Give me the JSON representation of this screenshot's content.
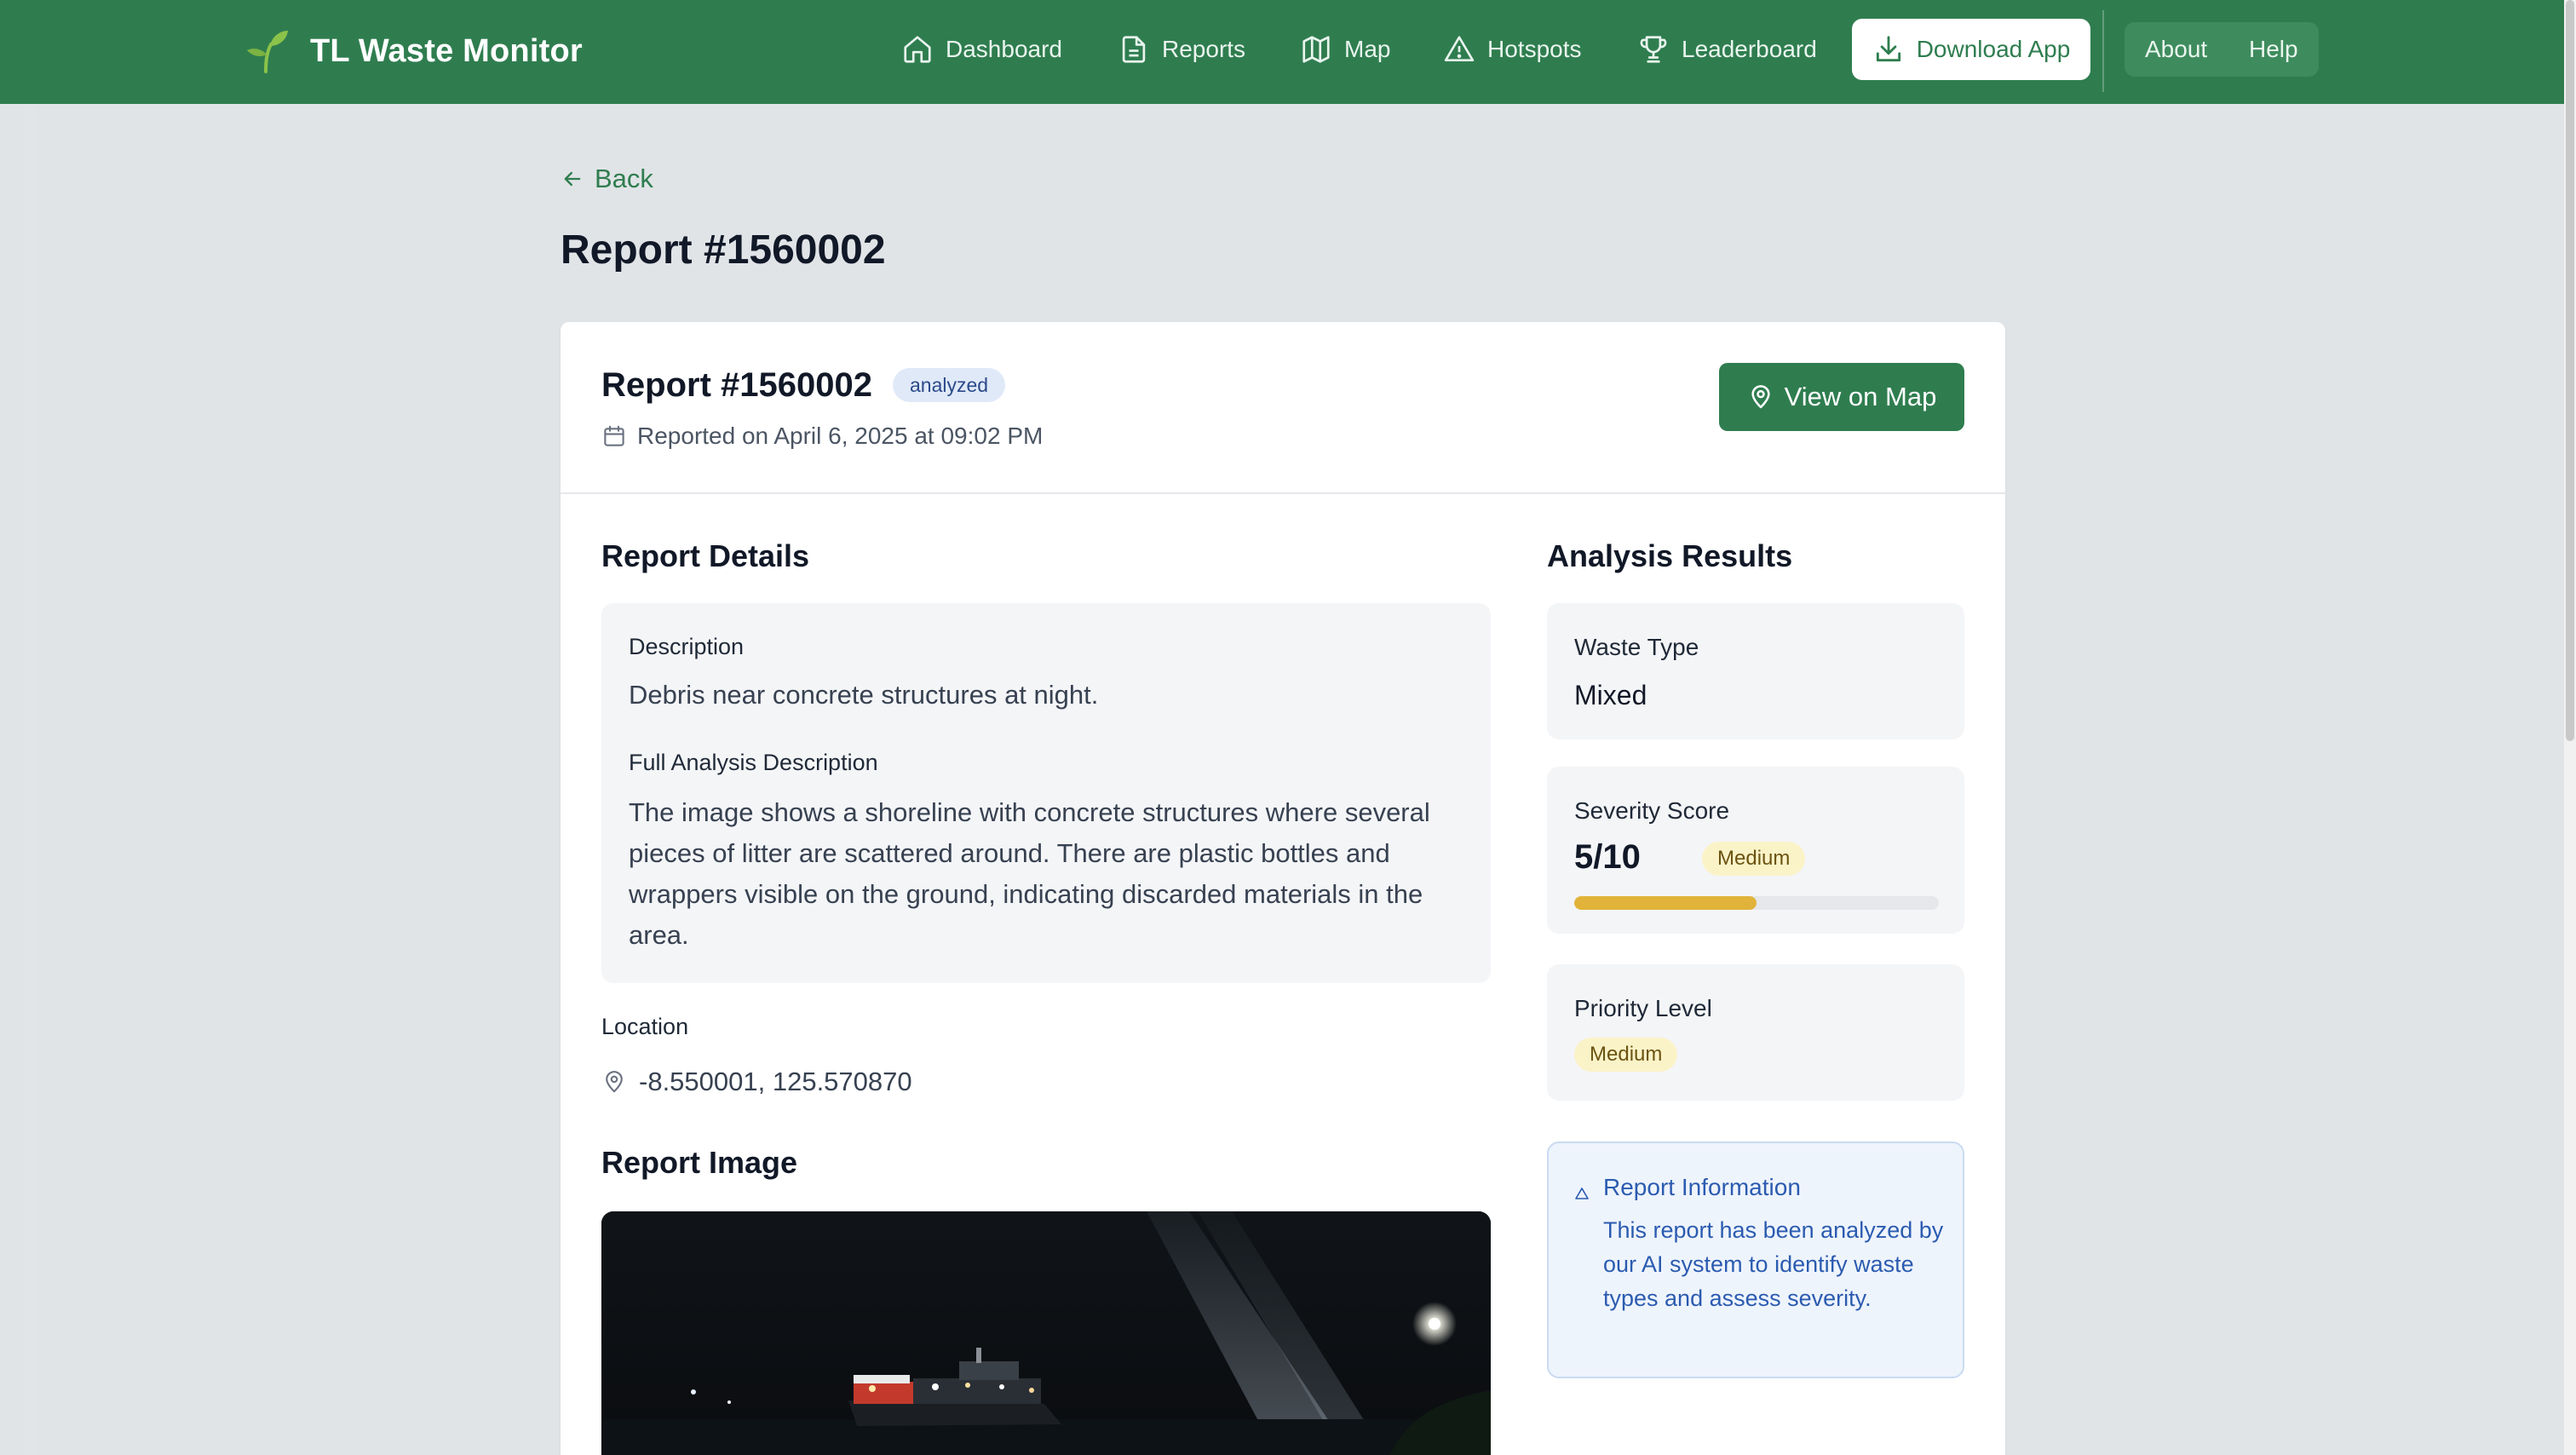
{
  "app": {
    "title": "TL Waste Monitor"
  },
  "nav": {
    "dashboard": "Dashboard",
    "reports": "Reports",
    "map": "Map",
    "hotspots": "Hotspots",
    "leaderboard": "Leaderboard",
    "download": "Download App",
    "about": "About",
    "help": "Help"
  },
  "page": {
    "back": "Back",
    "title": "Report #1560002"
  },
  "report": {
    "title": "Report #1560002",
    "status": "analyzed",
    "reported_on": "Reported on April 6, 2025 at 09:02 PM",
    "view_on_map": "View on Map"
  },
  "details": {
    "section_title": "Report Details",
    "description_label": "Description",
    "description": "Debris near concrete structures at night.",
    "full_label": "Full Analysis Description",
    "full_description": "The image shows a shoreline with concrete structures where several pieces of litter are scattered around. There are plastic bottles and wrappers visible on the ground, indicating discarded materials in the area.",
    "location_label": "Location",
    "location": "-8.550001, 125.570870",
    "image_title": "Report Image"
  },
  "analysis": {
    "section_title": "Analysis Results",
    "waste_type_label": "Waste Type",
    "waste_type": "Mixed",
    "severity_label": "Severity Score",
    "severity_score": "5/10",
    "severity_fraction": 0.5,
    "severity_level": "Medium",
    "priority_label": "Priority Level",
    "priority_level": "Medium"
  },
  "info": {
    "title": "Report Information",
    "text": "This report has been analyzed by our AI system to identify waste types and assess severity."
  },
  "colors": {
    "brand_green": "#2f7d4f",
    "status_badge_bg": "#e0e9f8",
    "medium_badge_bg": "#fbf3c8",
    "severity_bar": "#e2b33a",
    "info_blue": "#2b5bb0"
  },
  "icons": {
    "logo": "sprout-icon",
    "dashboard": "home-icon",
    "reports": "document-icon",
    "map": "map-icon",
    "hotspots": "warning-triangle-icon",
    "leaderboard": "trophy-icon",
    "download": "download-icon",
    "back": "arrow-left-icon",
    "calendar": "calendar-icon",
    "location": "map-pin-icon",
    "info": "info-icon"
  }
}
